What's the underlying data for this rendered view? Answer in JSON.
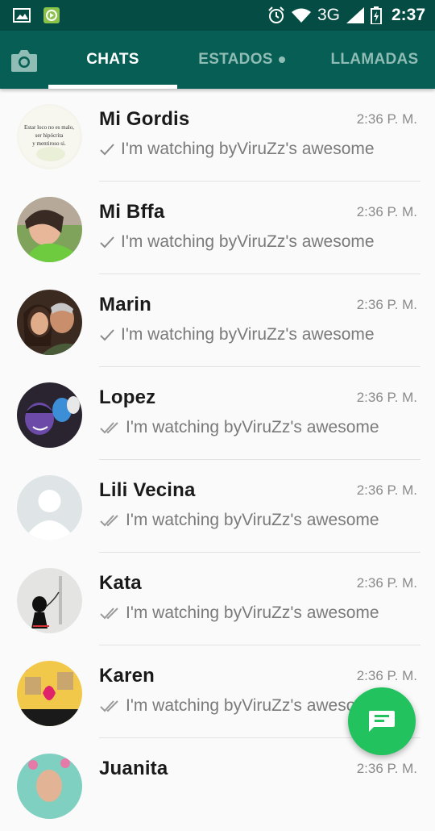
{
  "status_bar": {
    "left_icons": [
      "gallery-icon",
      "video-icon"
    ],
    "network": "3G",
    "time": "2:37",
    "bg_color": "#054d44"
  },
  "tabs": {
    "items": [
      {
        "label": "CHATS",
        "active": true
      },
      {
        "label": "ESTADOS",
        "active": false,
        "badge_dot": true
      },
      {
        "label": "LLAMADAS",
        "active": false
      }
    ],
    "bg_color": "#075e54"
  },
  "chats": [
    {
      "name": "Mi Gordis",
      "time": "2:36 P. M.",
      "preview": "I'm watching byViruZz's awesome",
      "ticks": "single",
      "avatar_text": [
        "Estar loco no es malo,",
        "ser hipócrita",
        "y mentiroso si."
      ]
    },
    {
      "name": "Mi Bffa",
      "time": "2:36 P. M.",
      "preview": "I'm watching byViruZz's awesome",
      "ticks": "single"
    },
    {
      "name": "Marin",
      "time": "2:36 P. M.",
      "preview": "I'm watching byViruZz's awesome",
      "ticks": "single"
    },
    {
      "name": "Lopez",
      "time": "2:36 P. M.",
      "preview": "I'm watching byViruZz's awesome",
      "ticks": "double"
    },
    {
      "name": "Lili Vecina",
      "time": "2:36 P. M.",
      "preview": "I'm watching byViruZz's awesome",
      "ticks": "double"
    },
    {
      "name": "Kata",
      "time": "2:36 P. M.",
      "preview": "I'm watching byViruZz's awesome",
      "ticks": "double"
    },
    {
      "name": "Karen",
      "time": "2:36 P. M.",
      "preview": "I'm watching byViruZz's awesome",
      "ticks": "double"
    },
    {
      "name": "Juanita",
      "time": "2:36 P. M.",
      "preview": "",
      "ticks": "none"
    }
  ],
  "fab": {
    "icon": "new-chat-icon",
    "color": "#22c35e"
  },
  "colors": {
    "accent": "#075e54",
    "fab": "#22c35e",
    "tab_inactive": "#8fbcb5"
  }
}
